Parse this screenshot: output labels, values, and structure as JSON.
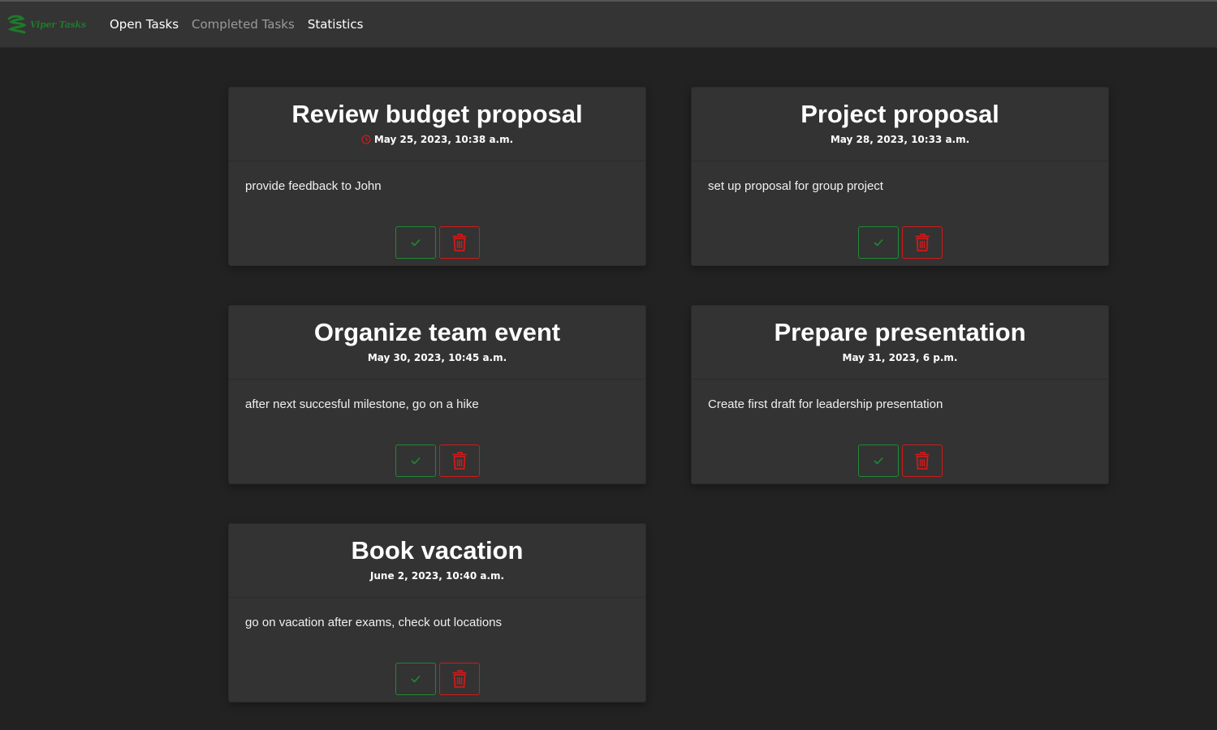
{
  "navbar": {
    "brand": "Viper Tasks",
    "links": [
      "Open Tasks",
      "Completed Tasks",
      "Statistics"
    ]
  },
  "colors": {
    "background": "#222222",
    "navbar": "#343434",
    "card": "#333333",
    "accent_green": "#1f8a34",
    "danger_red": "#d11a1a"
  },
  "tasks": [
    {
      "title": "Review budget proposal",
      "date": "May 25, 2023, 10:38 a.m.",
      "description": "provide feedback to John",
      "overdue_icon": "clock-icon"
    },
    {
      "title": "Project proposal",
      "date": "May 28, 2023, 10:33 a.m.",
      "description": "set up proposal for group project"
    },
    {
      "title": "Organize team event",
      "date": "May 30, 2023, 10:45 a.m.",
      "description": "after next succesful milestone, go on a hike"
    },
    {
      "title": "Prepare presentation",
      "date": "May 31, 2023, 6 p.m.",
      "description": "Create first draft for leadership presentation"
    },
    {
      "title": "Book vacation",
      "date": "June 2, 2023, 10:40 a.m.",
      "description": "go on vacation after exams, check out locations"
    }
  ],
  "icons": {
    "complete": "check-icon",
    "delete": "trash-icon"
  }
}
